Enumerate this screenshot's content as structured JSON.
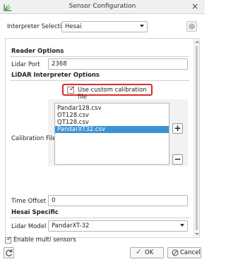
{
  "window": {
    "title": "Sensor Configuration"
  },
  "interpreter": {
    "label": "Interpreter Selection:",
    "value": "Hesai"
  },
  "reader_options": {
    "title": "Reader Options",
    "lidar_port_label": "Lidar Port",
    "lidar_port_value": "2368"
  },
  "lidar_interpreter": {
    "title": "LiDAR Interpreter Options",
    "use_custom_calibration_label": "Use custom calibration file",
    "use_custom_calibration_checked": true,
    "calibration_file_label": "Calibration File",
    "calibration_files": [
      "Pandar128.csv",
      "OT128.csv",
      "QT128.csv",
      "PandarXT32.csv"
    ],
    "selected_calibration": "PandarXT32.csv",
    "add_label": "+",
    "remove_label": "−",
    "time_offset_label": "Time Offset",
    "time_offset_value": "0"
  },
  "hesai_specific": {
    "title": "Hesai Specific",
    "lidar_model_label": "Lidar Model",
    "lidar_model_value": "PandarXT-32"
  },
  "multi_sensors": {
    "label": "Enable multi sensors",
    "checked": true
  },
  "buttons": {
    "ok_label": "OK",
    "cancel_label": "Cancel"
  },
  "colors": {
    "accent_selection": "#3b93d6",
    "highlight_border": "#d92b2b",
    "ok_check": "#2a8a2a",
    "checkbox_mark": "#c21010"
  }
}
